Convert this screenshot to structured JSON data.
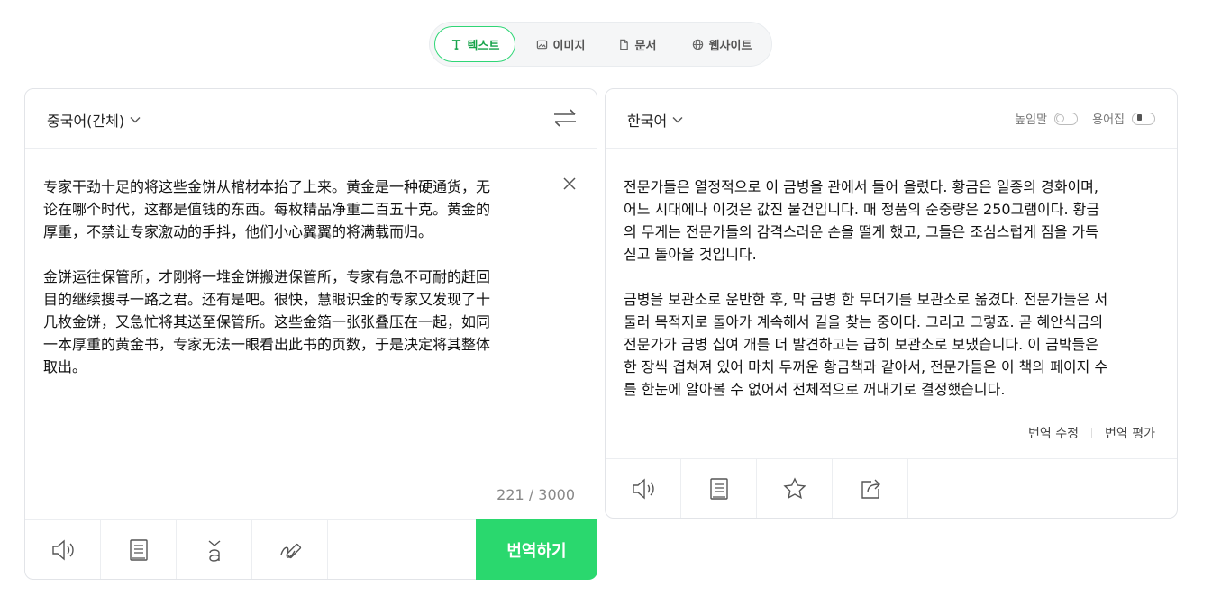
{
  "modes": [
    {
      "label": "텍스트",
      "icon": "text-icon",
      "active": true
    },
    {
      "label": "이미지",
      "icon": "image-icon",
      "active": false
    },
    {
      "label": "문서",
      "icon": "document-icon",
      "active": false
    },
    {
      "label": "웹사이트",
      "icon": "globe-icon",
      "active": false
    }
  ],
  "source": {
    "language": "중국어(간체)",
    "text": "专家干劲十足的将这些金饼从棺材本抬了上来。黄金是一种硬通货，无\n论在哪个时代，这都是值钱的东西。每枚精品净重二百五十克。黄金的\n厚重，不禁让专家激动的手抖，他们小心翼翼的将满载而归。\n\n金饼运往保管所，才刚将一堆金饼搬进保管所，专家有急不可耐的赶回\n目的继续搜寻一路之君。还有是吧。很快，慧眼识金的专家又发现了十\n几枚金饼，又急忙将其送至保管所。这些金箔一张张叠压在一起，如同\n一本厚重的黄金书，专家无法一眼看出此书的页数，于是决定将其整体\n取出。",
    "char_count": "221 / 3000",
    "translate_label": "번역하기"
  },
  "target": {
    "language": "한국어",
    "honorific_label": "높임말",
    "glossary_label": "용어집",
    "text": "전문가들은 열정적으로 이 금병을 관에서 들어 올렸다. 황금은 일종의 경화이며,\n어느 시대에나 이것은 값진 물건입니다. 매 정품의 순중량은 250그램이다. 황금\n의 무게는 전문가들의 감격스러운 손을 떨게 했고, 그들은 조심스럽게 짐을 가득\n싣고 돌아올 것입니다.\n\n금병을 보관소로 운반한 후, 막 금병 한 무더기를 보관소로 옮겼다. 전문가들은 서\n둘러 목적지로 돌아가 계속해서 길을 찾는 중이다. 그리고 그렇죠. 곧 혜안식금의\n전문가가 금병 십여 개를 더 발견하고는 급히 보관소로 보냈습니다. 이 금박들은\n한 장씩 겹쳐져 있어 마치 두꺼운 황금책과 같아서, 전문가들은 이 책의 페이지 수\n를 한눈에 알아볼 수 없어서 전체적으로 꺼내기로 결정했습니다.",
    "edit_label": "번역 수정",
    "rate_label": "번역 평가"
  },
  "colors": {
    "accent": "#2ad86e",
    "accent_text": "#16a34a"
  }
}
